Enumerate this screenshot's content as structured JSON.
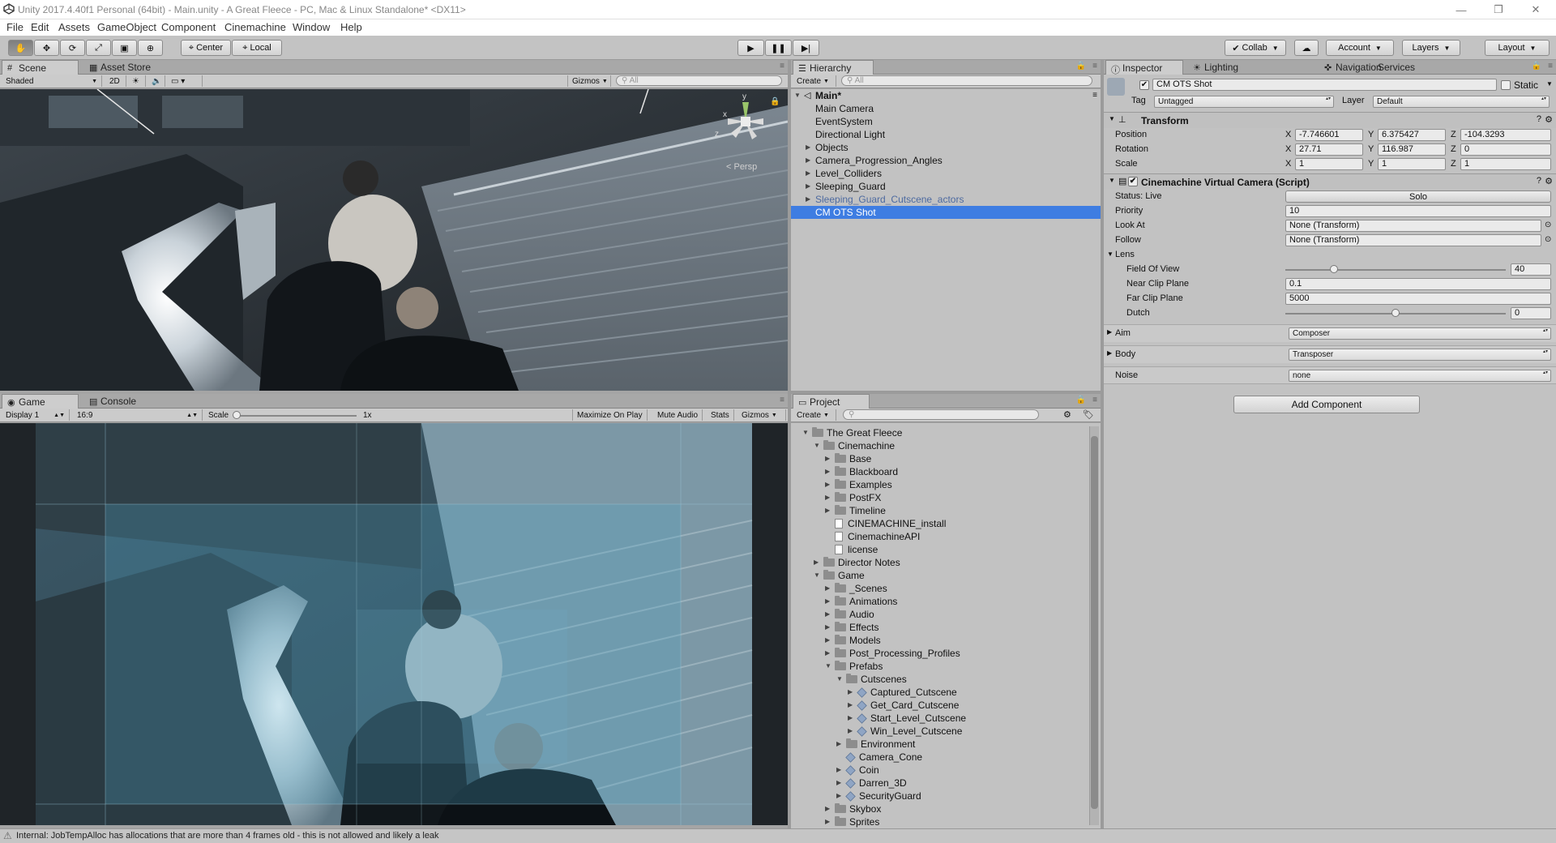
{
  "window": {
    "title": "Unity 2017.4.40f1 Personal (64bit) - Main.unity - A Great Fleece - PC, Mac & Linux Standalone* <DX11>",
    "minimize": "—",
    "restore": "❐",
    "close": "✕"
  },
  "menu": [
    "File",
    "Edit",
    "Assets",
    "GameObject",
    "Component",
    "Cinemachine",
    "Window",
    "Help"
  ],
  "toolbar": {
    "pivot": "Center",
    "space": "Local",
    "collab": "Collab",
    "account": "Account",
    "layers": "Layers",
    "layout": "Layout"
  },
  "scene": {
    "tab": "Scene",
    "tab2": "Asset Store",
    "shading": "Shaded",
    "mode2d": "2D",
    "gizmos": "Gizmos",
    "search_placeholder": "All",
    "persp": "< Persp",
    "axis_y": "y",
    "axis_x": "x",
    "axis_z": "z"
  },
  "game": {
    "tab": "Game",
    "tab2": "Console",
    "display": "Display 1",
    "aspect": "16:9",
    "scale_label": "Scale",
    "scale_value": "1x",
    "scale_fraction": 0.0,
    "maximize": "Maximize On Play",
    "mute": "Mute Audio",
    "stats": "Stats",
    "gizmos": "Gizmos"
  },
  "hierarchy": {
    "tab": "Hierarchy",
    "create": "Create",
    "search_placeholder": "All",
    "scene_name": "Main*",
    "items": [
      {
        "label": "Main Camera",
        "expandable": false,
        "selected": false,
        "prefab": false
      },
      {
        "label": "EventSystem",
        "expandable": false,
        "selected": false,
        "prefab": false
      },
      {
        "label": "Directional Light",
        "expandable": false,
        "selected": false,
        "prefab": false
      },
      {
        "label": "Objects",
        "expandable": true,
        "selected": false,
        "prefab": false
      },
      {
        "label": "Camera_Progression_Angles",
        "expandable": true,
        "selected": false,
        "prefab": false
      },
      {
        "label": "Level_Colliders",
        "expandable": true,
        "selected": false,
        "prefab": false
      },
      {
        "label": "Sleeping_Guard",
        "expandable": true,
        "selected": false,
        "prefab": false
      },
      {
        "label": "Sleeping_Guard_Cutscene_actors",
        "expandable": true,
        "selected": false,
        "prefab": true
      },
      {
        "label": "CM OTS Shot",
        "expandable": false,
        "selected": true,
        "prefab": false
      }
    ]
  },
  "project": {
    "tab": "Project",
    "create": "Create",
    "items": [
      {
        "label": "The Great Fleece",
        "depth": 0,
        "arrow": "▼",
        "icon": "folder"
      },
      {
        "label": "Cinemachine",
        "depth": 1,
        "arrow": "▼",
        "icon": "folder"
      },
      {
        "label": "Base",
        "depth": 2,
        "arrow": "▶",
        "icon": "folder"
      },
      {
        "label": "Blackboard",
        "depth": 2,
        "arrow": "▶",
        "icon": "folder"
      },
      {
        "label": "Examples",
        "depth": 2,
        "arrow": "▶",
        "icon": "folder"
      },
      {
        "label": "PostFX",
        "depth": 2,
        "arrow": "▶",
        "icon": "folder"
      },
      {
        "label": "Timeline",
        "depth": 2,
        "arrow": "▶",
        "icon": "folder"
      },
      {
        "label": "CINEMACHINE_install",
        "depth": 2,
        "arrow": "",
        "icon": "doc"
      },
      {
        "label": "CinemachineAPI",
        "depth": 2,
        "arrow": "",
        "icon": "doc"
      },
      {
        "label": "license",
        "depth": 2,
        "arrow": "",
        "icon": "doc"
      },
      {
        "label": "Director Notes",
        "depth": 1,
        "arrow": "▶",
        "icon": "folder"
      },
      {
        "label": "Game",
        "depth": 1,
        "arrow": "▼",
        "icon": "folder"
      },
      {
        "label": "_Scenes",
        "depth": 2,
        "arrow": "▶",
        "icon": "folder"
      },
      {
        "label": "Animations",
        "depth": 2,
        "arrow": "▶",
        "icon": "folder"
      },
      {
        "label": "Audio",
        "depth": 2,
        "arrow": "▶",
        "icon": "folder"
      },
      {
        "label": "Effects",
        "depth": 2,
        "arrow": "▶",
        "icon": "folder"
      },
      {
        "label": "Models",
        "depth": 2,
        "arrow": "▶",
        "icon": "folder"
      },
      {
        "label": "Post_Processing_Profiles",
        "depth": 2,
        "arrow": "▶",
        "icon": "folder"
      },
      {
        "label": "Prefabs",
        "depth": 2,
        "arrow": "▼",
        "icon": "folder"
      },
      {
        "label": "Cutscenes",
        "depth": 3,
        "arrow": "▼",
        "icon": "folder"
      },
      {
        "label": "Captured_Cutscene",
        "depth": 4,
        "arrow": "▶",
        "icon": "prefab"
      },
      {
        "label": "Get_Card_Cutscene",
        "depth": 4,
        "arrow": "▶",
        "icon": "prefab"
      },
      {
        "label": "Start_Level_Cutscene",
        "depth": 4,
        "arrow": "▶",
        "icon": "prefab"
      },
      {
        "label": "Win_Level_Cutscene",
        "depth": 4,
        "arrow": "▶",
        "icon": "prefab"
      },
      {
        "label": "Environment",
        "depth": 3,
        "arrow": "▶",
        "icon": "folder"
      },
      {
        "label": "Camera_Cone",
        "depth": 3,
        "arrow": "",
        "icon": "prefab"
      },
      {
        "label": "Coin",
        "depth": 3,
        "arrow": "▶",
        "icon": "prefab"
      },
      {
        "label": "Darren_3D",
        "depth": 3,
        "arrow": "▶",
        "icon": "prefab"
      },
      {
        "label": "SecurityGuard",
        "depth": 3,
        "arrow": "▶",
        "icon": "prefab"
      },
      {
        "label": "Skybox",
        "depth": 2,
        "arrow": "▶",
        "icon": "folder"
      },
      {
        "label": "Sprites",
        "depth": 2,
        "arrow": "▶",
        "icon": "folder"
      }
    ]
  },
  "inspector": {
    "tabs": [
      "Inspector",
      "Lighting",
      "Navigation",
      "Services"
    ],
    "object_name": "CM OTS Shot",
    "static_label": "Static",
    "tag_label": "Tag",
    "tag_value": "Untagged",
    "layer_label": "Layer",
    "layer_value": "Default",
    "transform": {
      "title": "Transform",
      "position_label": "Position",
      "rotation_label": "Rotation",
      "scale_label": "Scale",
      "position": {
        "x": "-7.746601",
        "y": "6.375427",
        "z": "-104.3293"
      },
      "rotation": {
        "x": "27.71",
        "y": "116.987",
        "z": "0"
      },
      "scale": {
        "x": "1",
        "y": "1",
        "z": "1"
      }
    },
    "vcam": {
      "title": "Cinemachine Virtual Camera (Script)",
      "status_label": "Status: Live",
      "solo": "Solo",
      "priority_label": "Priority",
      "priority": "10",
      "lookat_label": "Look At",
      "lookat": "None (Transform)",
      "follow_label": "Follow",
      "follow": "None (Transform)",
      "lens_label": "Lens",
      "fov_label": "Field Of View",
      "fov": "40",
      "fov_fraction": 0.22,
      "near_label": "Near Clip Plane",
      "near": "0.1",
      "far_label": "Far Clip Plane",
      "far": "5000",
      "dutch_label": "Dutch",
      "dutch": "0",
      "dutch_fraction": 0.5,
      "aim_label": "Aim",
      "aim": "Composer",
      "body_label": "Body",
      "body": "Transposer",
      "noise_label": "Noise",
      "noise": "none"
    },
    "add_component": "Add Component"
  },
  "status": {
    "message": "Internal: JobTempAlloc has allocations that are more than 4 frames old - this is not allowed and likely a leak"
  }
}
